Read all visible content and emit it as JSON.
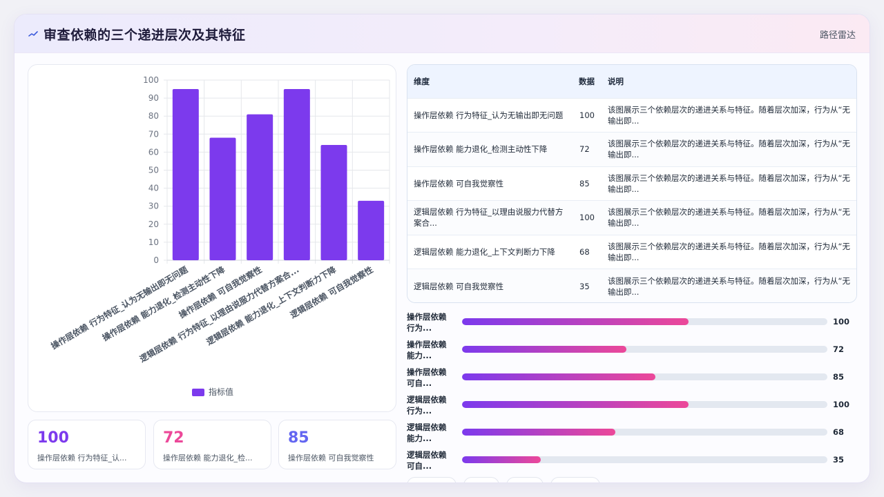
{
  "header": {
    "title": "审查依赖的三个递进层次及其特征",
    "link": "路径雷达",
    "icon": "chart-line-icon"
  },
  "chart_data": {
    "type": "bar",
    "categories": [
      "操作层依赖 行为特征_认为无输出即无问题",
      "操作层依赖 能力退化_检测主动性下降",
      "操作层依赖 可自我觉察性",
      "逻辑层依赖 行为特征_以理由说服力代替方案合...",
      "逻辑层依赖 能力退化_上下文判断力下降",
      "逻辑层依赖 可自我觉察性"
    ],
    "series": [
      {
        "name": "指标值",
        "values": [
          95,
          68,
          81,
          95,
          64,
          33
        ]
      }
    ],
    "ylim": [
      0,
      100
    ],
    "yticks": [
      0,
      10,
      20,
      30,
      40,
      50,
      60,
      70,
      80,
      90,
      100
    ],
    "grid": true,
    "legend": "bottom",
    "bar_color": "#7c3aed"
  },
  "kpis": [
    {
      "value": "100",
      "label": "操作层依赖 行为特征_认...",
      "color": "#7c3aed"
    },
    {
      "value": "72",
      "label": "操作层依赖 能力退化_检...",
      "color": "#ec4899"
    },
    {
      "value": "85",
      "label": "操作层依赖 可自我觉察性",
      "color": "#6366f1"
    }
  ],
  "table": {
    "headers": [
      "维度",
      "数据",
      "说明"
    ],
    "rows": [
      {
        "dim": "操作层依赖 行为特征_认为无输出即无问题",
        "value": "100",
        "desc": "该图展示三个依赖层次的递进关系与特征。随着层次加深，行为从“无输出即..."
      },
      {
        "dim": "操作层依赖 能力退化_检测主动性下降",
        "value": "72",
        "desc": "该图展示三个依赖层次的递进关系与特征。随着层次加深，行为从“无输出即..."
      },
      {
        "dim": "操作层依赖 可自我觉察性",
        "value": "85",
        "desc": "该图展示三个依赖层次的递进关系与特征。随着层次加深，行为从“无输出即..."
      },
      {
        "dim": "逻辑层依赖 行为特征_以理由说服力代替方案合...",
        "value": "100",
        "desc": "该图展示三个依赖层次的递进关系与特征。随着层次加深，行为从“无输出即..."
      },
      {
        "dim": "逻辑层依赖 能力退化_上下文判断力下降",
        "value": "68",
        "desc": "该图展示三个依赖层次的递进关系与特征。随着层次加深，行为从“无输出即..."
      },
      {
        "dim": "逻辑层依赖 可自我觉察性",
        "value": "35",
        "desc": "该图展示三个依赖层次的递进关系与特征。随着层次加深，行为从“无输出即..."
      }
    ]
  },
  "progress": [
    {
      "label": "操作层依赖 行为...",
      "value": "100",
      "fraction": 0.62
    },
    {
      "label": "操作层依赖 能力...",
      "value": "72",
      "fraction": 0.45
    },
    {
      "label": "操作层依赖 可自...",
      "value": "85",
      "fraction": 0.53
    },
    {
      "label": "逻辑层依赖 行为...",
      "value": "100",
      "fraction": 0.62
    },
    {
      "label": "逻辑层依赖 能力...",
      "value": "68",
      "fraction": 0.42
    },
    {
      "label": "逻辑层依赖 可自...",
      "value": "35",
      "fraction": 0.215
    }
  ]
}
